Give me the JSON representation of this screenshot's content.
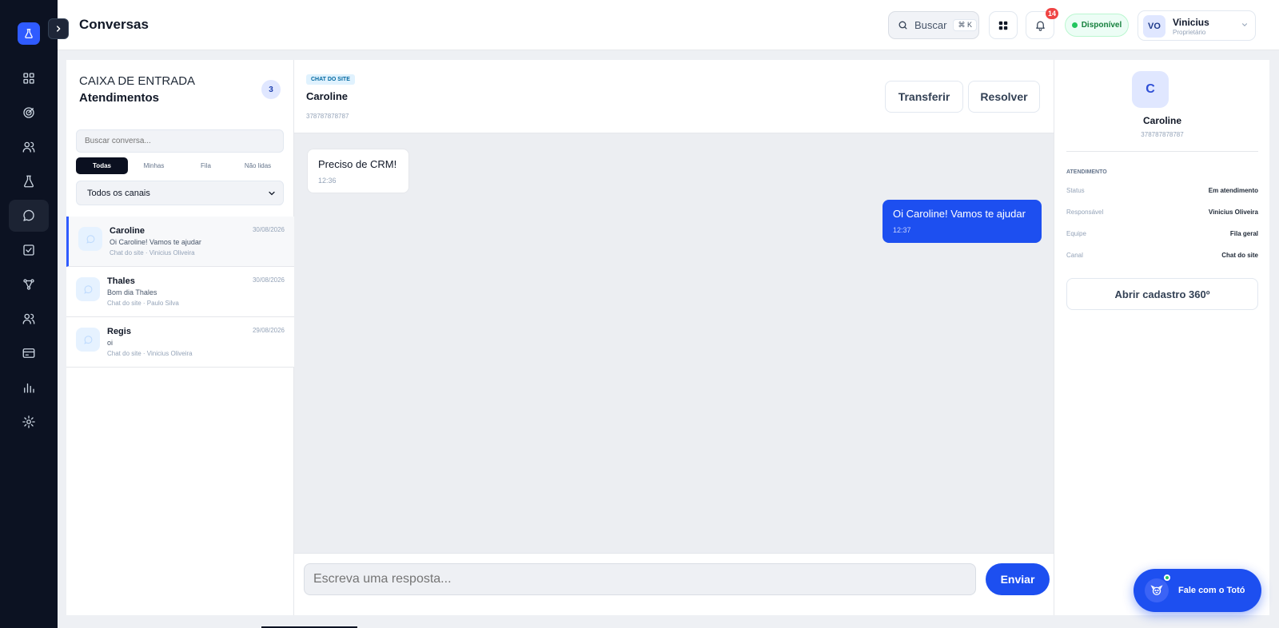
{
  "topbar": {
    "title": "Conversas",
    "search_label": "Buscar",
    "search_shortcut": "⌘ K",
    "notifications_count": "14",
    "status": "Disponível",
    "user": {
      "initials": "VO",
      "name": "Vinicius",
      "role": "Proprietário"
    }
  },
  "sidebar": {
    "items": [
      {
        "name": "dashboard",
        "icon": "grid-icon",
        "active": false
      },
      {
        "name": "targets",
        "icon": "target-icon",
        "active": false
      },
      {
        "name": "contacts",
        "icon": "users-icon",
        "active": false
      },
      {
        "name": "lab",
        "icon": "flask-icon",
        "active": false
      },
      {
        "name": "conversations",
        "icon": "chat-icon",
        "active": true
      },
      {
        "name": "tasks",
        "icon": "checkbox-icon",
        "active": false
      },
      {
        "name": "flows",
        "icon": "flow-icon",
        "active": false
      },
      {
        "name": "team",
        "icon": "team-icon",
        "active": false
      },
      {
        "name": "billing",
        "icon": "card-icon",
        "active": false
      },
      {
        "name": "reports",
        "icon": "bar-chart-icon",
        "active": false
      },
      {
        "name": "settings",
        "icon": "gear-icon",
        "active": false
      }
    ]
  },
  "inbox": {
    "kicker": "CAIXA DE ENTRADA",
    "title": "Atendimentos",
    "count": "3",
    "search_placeholder": "Buscar conversa...",
    "filters": [
      "Todas",
      "Minhas",
      "Fila",
      "Não lidas"
    ],
    "channel": "Todos os canais",
    "conversations": [
      {
        "name": "Caroline",
        "date": "30/08/2026",
        "message": "Oi Caroline! Vamos te ajudar",
        "meta": "Chat do site · Vinicius Oliveira"
      },
      {
        "name": "Thales",
        "date": "30/08/2026",
        "message": "Bom dia Thales",
        "meta": "Chat do site · Paulo Silva"
      },
      {
        "name": "Regis",
        "date": "29/08/2026",
        "message": "oi",
        "meta": "Chat do site · Vinicius Oliveira"
      }
    ]
  },
  "chat": {
    "tag": "CHAT DO SITE",
    "name": "Caroline",
    "phone": "378787878787",
    "transfer": "Transferir",
    "resolve": "Resolver",
    "messages": [
      {
        "text": "Preciso de CRM!",
        "time": "12:36",
        "direction": "in"
      },
      {
        "text": "Oi Caroline! Vamos te ajudar",
        "time": "12:37",
        "direction": "out"
      }
    ],
    "composer_placeholder": "Escreva uma resposta...",
    "send": "Enviar"
  },
  "contact": {
    "initial": "C",
    "name": "Caroline",
    "phone": "378787878787",
    "section": "ATENDIMENTO",
    "rows": [
      {
        "label": "Status",
        "value": "Em atendimento"
      },
      {
        "label": "Responsável",
        "value": "Vinicius Oliveira"
      },
      {
        "label": "Equipe",
        "value": "Fila geral"
      },
      {
        "label": "Canal",
        "value": "Chat do site"
      }
    ],
    "open_profile": "Abrir cadastro 360º"
  },
  "assistant": {
    "label": "Fale com o Totó"
  },
  "colors": {
    "accent": "#1d4ff0",
    "sidebar": "#0c1222",
    "online": "#22c55e",
    "alert": "#ef4444"
  }
}
